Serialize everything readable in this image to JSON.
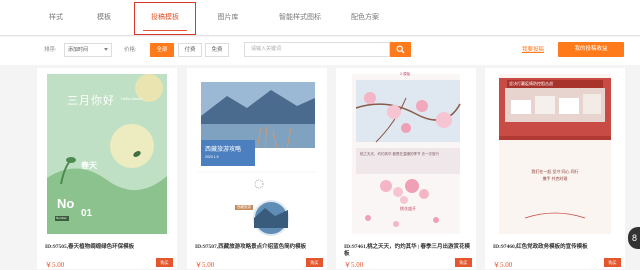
{
  "tabs": [
    {
      "label": "样式",
      "active": false
    },
    {
      "label": "模板",
      "active": false
    },
    {
      "label": "投稿模板",
      "active": true
    },
    {
      "label": "图片库",
      "active": false
    },
    {
      "label": "智能样式图标",
      "active": false
    },
    {
      "label": "配色方案",
      "active": false
    }
  ],
  "filters": {
    "sort_label": "排序:",
    "sort_value": "添加时间",
    "price_label": "价格:",
    "price_options": [
      "全部",
      "付费",
      "免费"
    ],
    "price_selected": "全部",
    "search_placeholder": "请输入关键词",
    "my_submissions": "我要投稿",
    "my_earnings": "我的投稿收益"
  },
  "cards": [
    {
      "title": "ID:97505,春天植物绸缎绿色环保模板",
      "price": "￥5.00",
      "buy": "购买",
      "thumb": {
        "heading": "三月你好",
        "sub": "Hello March",
        "season": "春天",
        "no": "No",
        "num": "01",
        "tag": "Number"
      }
    },
    {
      "title": "ID:97507,西藏旅游攻略景点介绍蓝色简约模板",
      "price": "￥5.00",
      "buy": "购买",
      "thumb": {
        "banner": "西藏旅游攻略",
        "date": "2020.1.5",
        "badge": "西藏旅游"
      }
    },
    {
      "title": "ID:97461,桃之天天，灼灼其华 | 春季三月出游赏花模板",
      "price": "￥5.00",
      "buy": "购买",
      "thumb": {
        "top": "X 模板",
        "quote": "桃之天天，灼灼其华 都是在温暖的季节 去一次旅行",
        "badge": "桃花盛开"
      }
    },
    {
      "title": "ID:97460,红色党政政务模板的宣传模板",
      "price": "￥5.00",
      "buy": "购买",
      "thumb": {
        "banner": "坚决打赢疫情防控阻击战",
        "poem": "我们在一起 坚守 同心 同行 携手 共克时艰"
      }
    }
  ],
  "float_btn": "8"
}
